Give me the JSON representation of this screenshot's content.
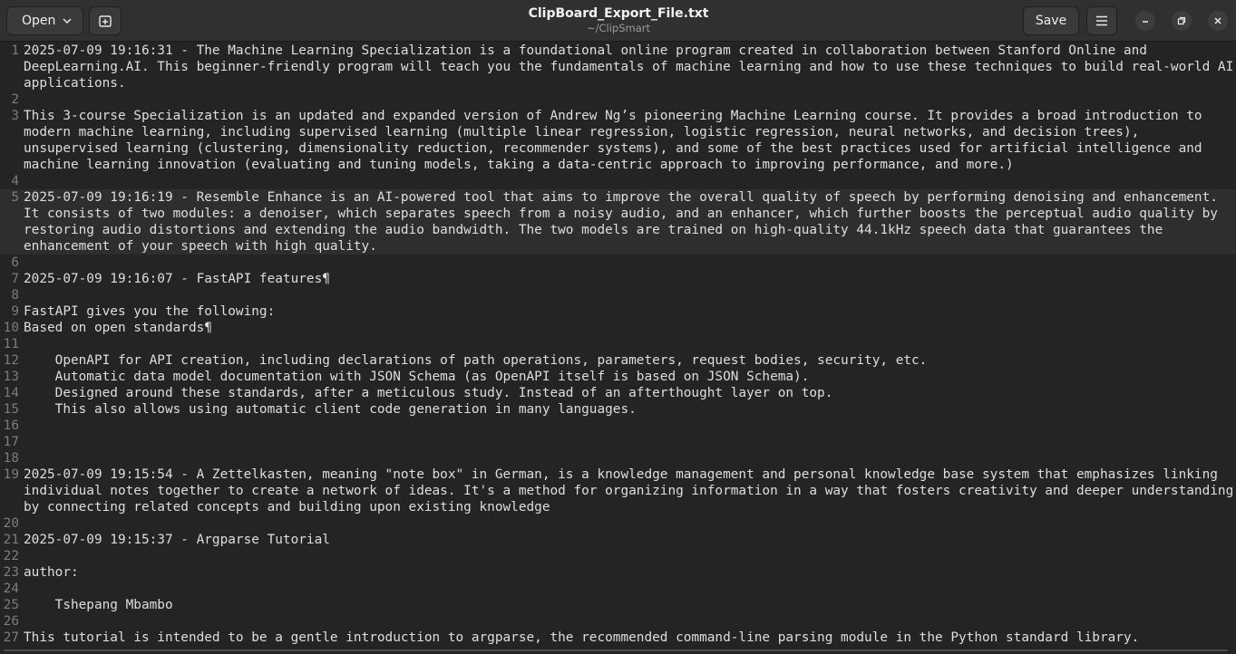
{
  "header": {
    "open_label": "Open",
    "save_label": "Save",
    "title": "ClipBoard_Export_File.txt",
    "subtitle": "~/ClipSmart"
  },
  "editor": {
    "lines": [
      {
        "n": "1",
        "t": "2025-07-09 19:16:31 - The Machine Learning Specialization is a foundational online program created in collaboration between Stanford Online and DeepLearning.AI. This beginner-friendly program will teach you the fundamentals of machine learning and how to use these techniques to build real-world AI applications."
      },
      {
        "n": "2",
        "t": ""
      },
      {
        "n": "3",
        "t": "This 3-course Specialization is an updated and expanded version of Andrew Ng’s pioneering Machine Learning course. It provides a broad introduction to modern machine learning, including supervised learning (multiple linear regression, logistic regression, neural networks, and decision trees), unsupervised learning (clustering, dimensionality reduction, recommender systems), and some of the best practices used for artificial intelligence and machine learning innovation (evaluating and tuning models, taking a data-centric approach to improving performance, and more.)"
      },
      {
        "n": "4",
        "t": ""
      },
      {
        "n": "5",
        "t": "2025-07-09 19:16:19 - Resemble Enhance is an AI-powered tool that aims to improve the overall quality of speech by performing denoising and enhancement. It consists of two modules: a denoiser, which separates speech from a noisy audio, and an enhancer, which further boosts the perceptual audio quality by restoring audio distortions and extending the audio bandwidth. The two models are trained on high-quality 44.1kHz speech data that guarantees the enhancement of your speech with high quality.",
        "current": true
      },
      {
        "n": "6",
        "t": ""
      },
      {
        "n": "7",
        "t": "2025-07-09 19:16:07 - FastAPI features¶"
      },
      {
        "n": "8",
        "t": ""
      },
      {
        "n": "9",
        "t": "FastAPI gives you the following:"
      },
      {
        "n": "10",
        "t": "Based on open standards¶"
      },
      {
        "n": "11",
        "t": ""
      },
      {
        "n": "12",
        "t": "    OpenAPI for API creation, including declarations of path operations, parameters, request bodies, security, etc."
      },
      {
        "n": "13",
        "t": "    Automatic data model documentation with JSON Schema (as OpenAPI itself is based on JSON Schema)."
      },
      {
        "n": "14",
        "t": "    Designed around these standards, after a meticulous study. Instead of an afterthought layer on top."
      },
      {
        "n": "15",
        "t": "    This also allows using automatic client code generation in many languages."
      },
      {
        "n": "16",
        "t": ""
      },
      {
        "n": "17",
        "t": ""
      },
      {
        "n": "18",
        "t": ""
      },
      {
        "n": "19",
        "t": "2025-07-09 19:15:54 - A Zettelkasten, meaning \"note box\" in German, is a knowledge management and personal knowledge base system that emphasizes linking individual notes together to create a network of ideas. It's a method for organizing information in a way that fosters creativity and deeper understanding by connecting related concepts and building upon existing knowledge"
      },
      {
        "n": "20",
        "t": ""
      },
      {
        "n": "21",
        "t": "2025-07-09 19:15:37 - Argparse Tutorial"
      },
      {
        "n": "22",
        "t": ""
      },
      {
        "n": "23",
        "t": "author:"
      },
      {
        "n": "24",
        "t": ""
      },
      {
        "n": "25",
        "t": "    Tshepang Mbambo"
      },
      {
        "n": "26",
        "t": ""
      },
      {
        "n": "27",
        "t": "This tutorial is intended to be a gentle introduction to argparse, the recommended command-line parsing module in the Python standard library."
      }
    ]
  }
}
